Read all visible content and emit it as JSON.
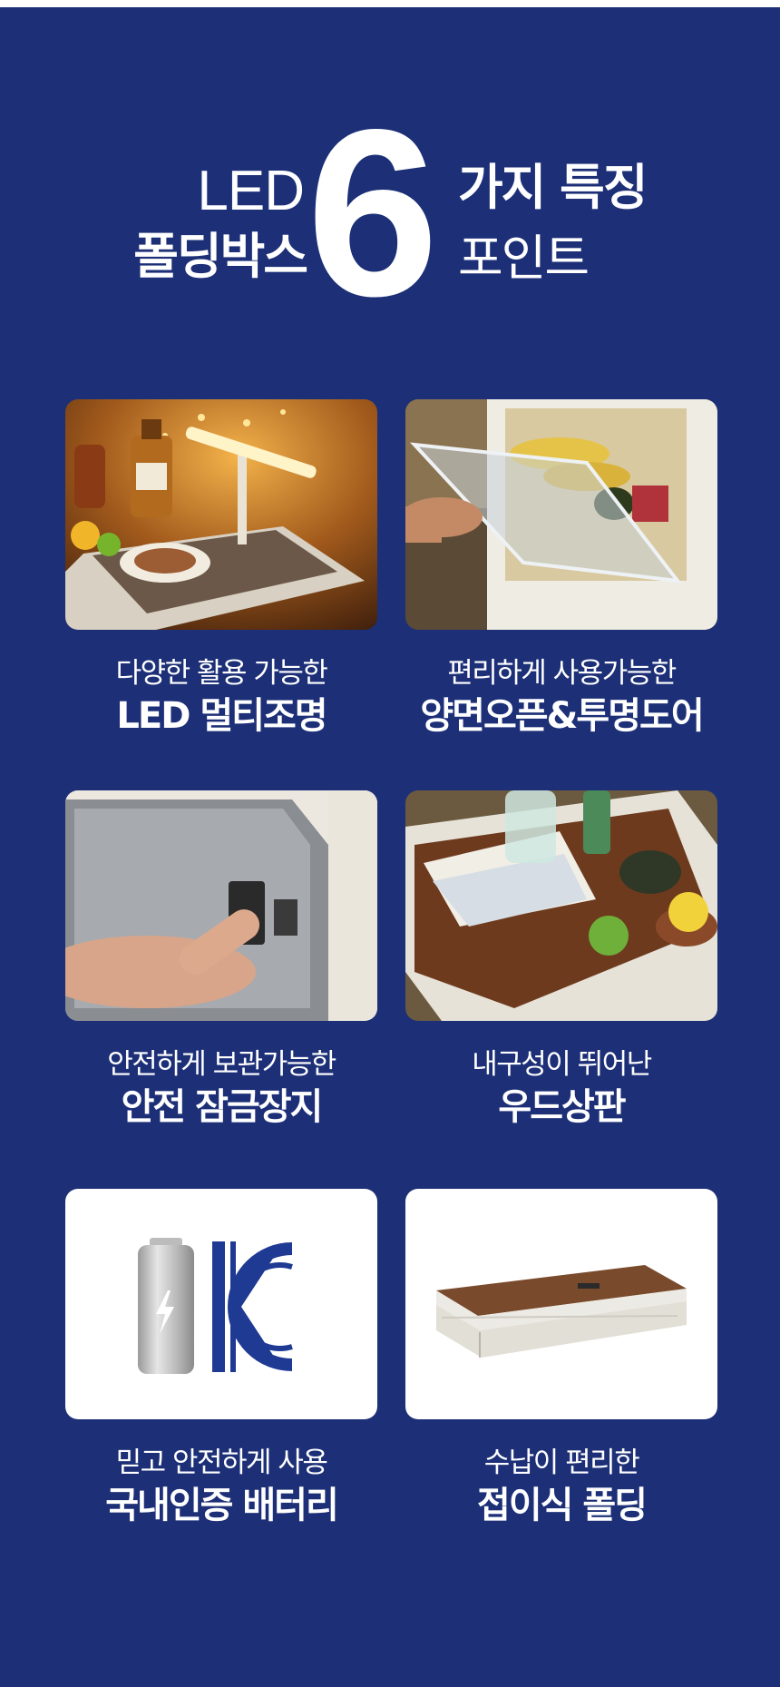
{
  "heading": {
    "led": "LED",
    "folding_box": "폴딩박스",
    "number": "6",
    "features": "가지 특징",
    "point": "포인트"
  },
  "features": [
    {
      "subtitle": "다양한 활용 가능한",
      "title": "LED 멀티조명"
    },
    {
      "subtitle": "편리하게 사용가능한",
      "title": "양면오픈&투명도어"
    },
    {
      "subtitle": "안전하게 보관가능한",
      "title": "안전 잠금장지"
    },
    {
      "subtitle": "내구성이 뛰어난",
      "title": "우드상판"
    },
    {
      "subtitle": "믿고 안전하게 사용",
      "title": "국내인증 배터리"
    },
    {
      "subtitle": "수납이 편리한",
      "title": "접이식 폴딩"
    }
  ],
  "colors": {
    "background": "#1c2f77",
    "text": "#ffffff",
    "kc_mark": "#1f3a93"
  },
  "icons": {
    "battery": "battery-icon",
    "kc_certification": "kc-mark-icon"
  }
}
